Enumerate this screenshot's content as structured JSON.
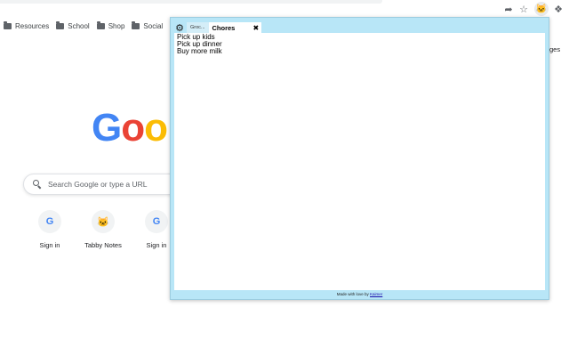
{
  "browser": {
    "toolbar_icons": [
      "share-icon",
      "star-icon",
      "extension-tabby-icon",
      "puzzle-icon"
    ]
  },
  "bookmarks": [
    {
      "label": "Resources",
      "icon": "folder-icon"
    },
    {
      "label": "School",
      "icon": "folder-icon"
    },
    {
      "label": "Shop",
      "icon": "folder-icon"
    },
    {
      "label": "Social",
      "icon": "folder-icon"
    }
  ],
  "ntp": {
    "logo_visible": "Goo",
    "logo_colors": [
      "#4285f4",
      "#ea4335",
      "#fbbc05"
    ],
    "search_placeholder": "Search Google or type a URL",
    "shortcuts": [
      {
        "label": "Sign in",
        "icon": "google-g-icon"
      },
      {
        "label": "Tabby Notes",
        "icon": "tabby-cat-icon"
      },
      {
        "label": "Sign in",
        "icon": "google-g-icon"
      }
    ],
    "edge_text": "ges"
  },
  "popup": {
    "accent_color": "#b8e6f7",
    "tabs": [
      {
        "label": "Groc...",
        "active": false
      },
      {
        "label": "Chores",
        "active": true
      }
    ],
    "close_symbol": "✖",
    "settings_icon": "gear-icon",
    "notes": [
      "Pick up kids",
      "Pick up dinner",
      "Buy more milk"
    ],
    "footer_text": "Made with love by",
    "footer_link": "Kaimer"
  }
}
